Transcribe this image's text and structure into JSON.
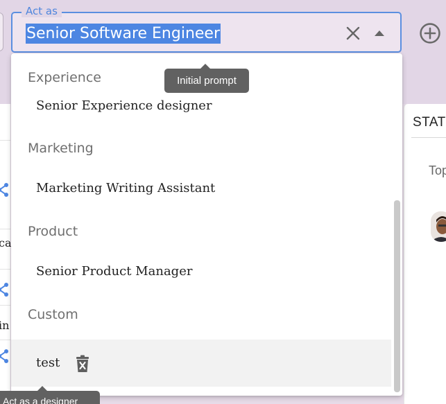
{
  "field": {
    "label": "Act as",
    "value": "Senior Software Engineer"
  },
  "dropdown": {
    "groups": [
      {
        "header": "Experience",
        "options": [
          "Senior Experience designer"
        ]
      },
      {
        "header": "Marketing",
        "options": [
          "Marketing Writing Assistant"
        ]
      },
      {
        "header": "Product",
        "options": [
          "Senior Product Manager"
        ]
      },
      {
        "header": "Custom",
        "options": [
          "test"
        ]
      }
    ]
  },
  "tooltips": {
    "initial_prompt": "Initial prompt",
    "act_as_designer": "Act as a designer"
  },
  "background": {
    "left_fragments": [
      "ca",
      "in"
    ],
    "stats_title": "STATS",
    "stats_sub": "Top"
  },
  "icons": {
    "clear": "close-icon",
    "open": "arrow-drop-up-icon",
    "add": "add-circle-icon",
    "delete": "delete-forever-icon",
    "share": "share-icon"
  },
  "colors": {
    "accent": "#4d86e2",
    "field_border": "#5b8fe0",
    "tooltip_bg": "#616161",
    "page_bg": "#e2d6e6",
    "highlight": "#f2f2f2"
  }
}
